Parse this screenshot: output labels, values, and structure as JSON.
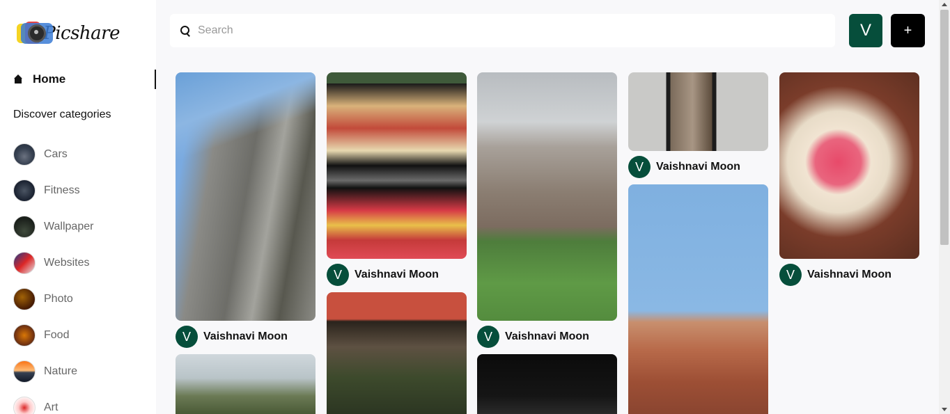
{
  "app": {
    "name": "Picshare"
  },
  "sidebar": {
    "home_label": "Home",
    "discover_title": "Discover categories",
    "categories": [
      {
        "label": "Cars"
      },
      {
        "label": "Fitness"
      },
      {
        "label": "Wallpaper"
      },
      {
        "label": "Websites"
      },
      {
        "label": "Photo"
      },
      {
        "label": "Food"
      },
      {
        "label": "Nature"
      },
      {
        "label": "Art"
      }
    ]
  },
  "header": {
    "search_placeholder": "Search",
    "search_value": "",
    "avatar_initial": "V",
    "create_label": "+"
  },
  "feed": {
    "pins": [
      {
        "author": "Vaishnavi Moon",
        "author_initial": "V"
      },
      {
        "author": "",
        "author_initial": ""
      },
      {
        "author": "Vaishnavi Moon",
        "author_initial": "V"
      },
      {
        "author": "",
        "author_initial": ""
      },
      {
        "author": "Vaishnavi Moon",
        "author_initial": "V"
      },
      {
        "author": "",
        "author_initial": ""
      },
      {
        "author": "Vaishnavi Moon",
        "author_initial": "V"
      },
      {
        "author": "",
        "author_initial": ""
      },
      {
        "author": "Vaishnavi Moon",
        "author_initial": "V"
      }
    ]
  },
  "colors": {
    "accent_green": "#064e3b",
    "black": "#000000",
    "background": "#f8f8fa"
  }
}
